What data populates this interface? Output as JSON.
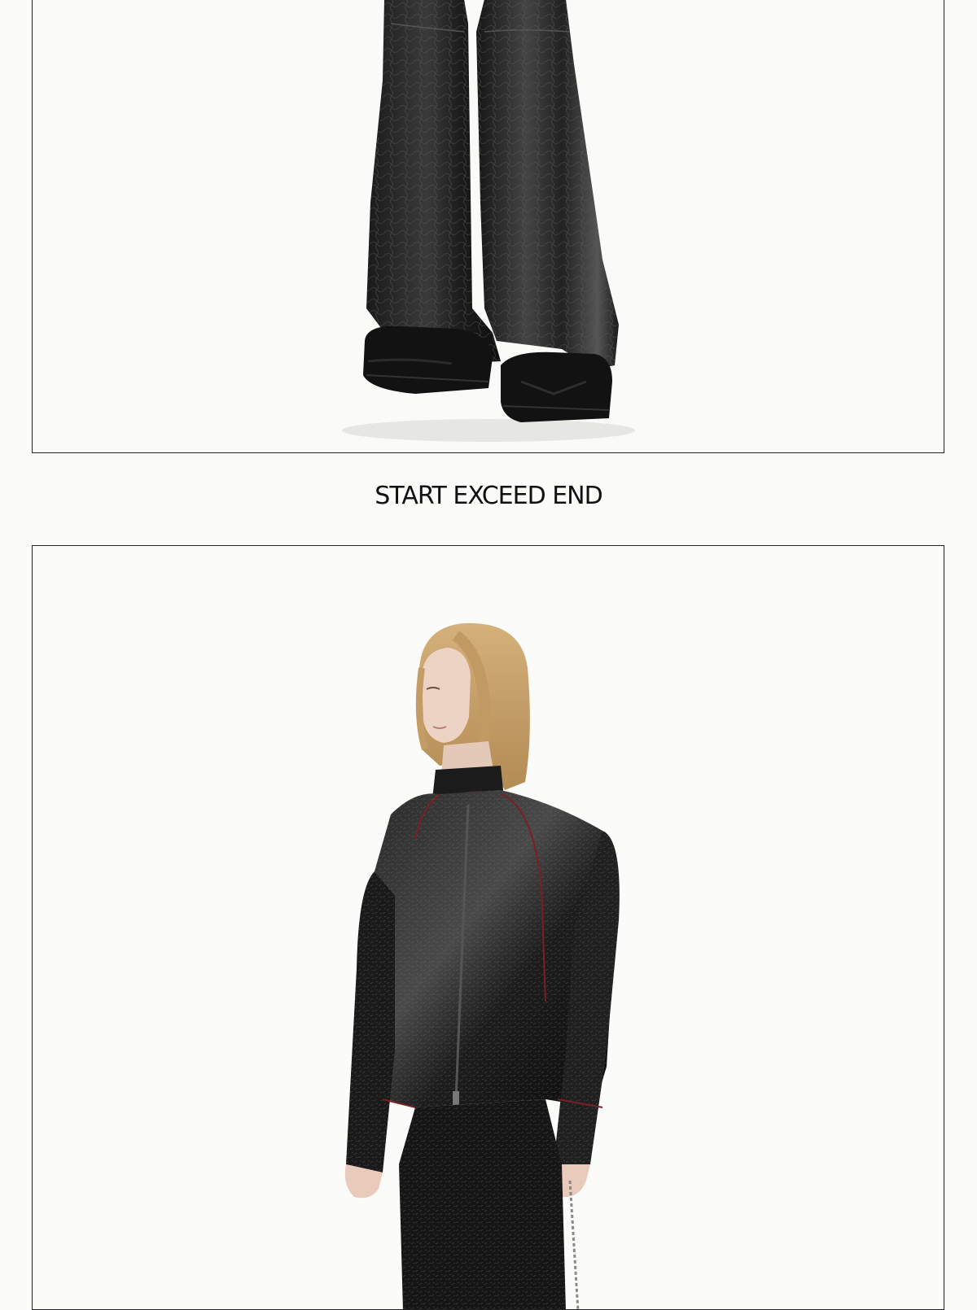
{
  "section_title": "START EXCEED END",
  "photos": [
    {
      "name": "lookbook-photo-trousers-boots"
    },
    {
      "name": "lookbook-photo-jacket-model"
    }
  ],
  "colors": {
    "page_background": "#fbfbfa",
    "frame_border": "#222222",
    "garment_black": "#111111",
    "hair_blond": "#c9a56e",
    "stitch_red": "#7a1f24"
  }
}
